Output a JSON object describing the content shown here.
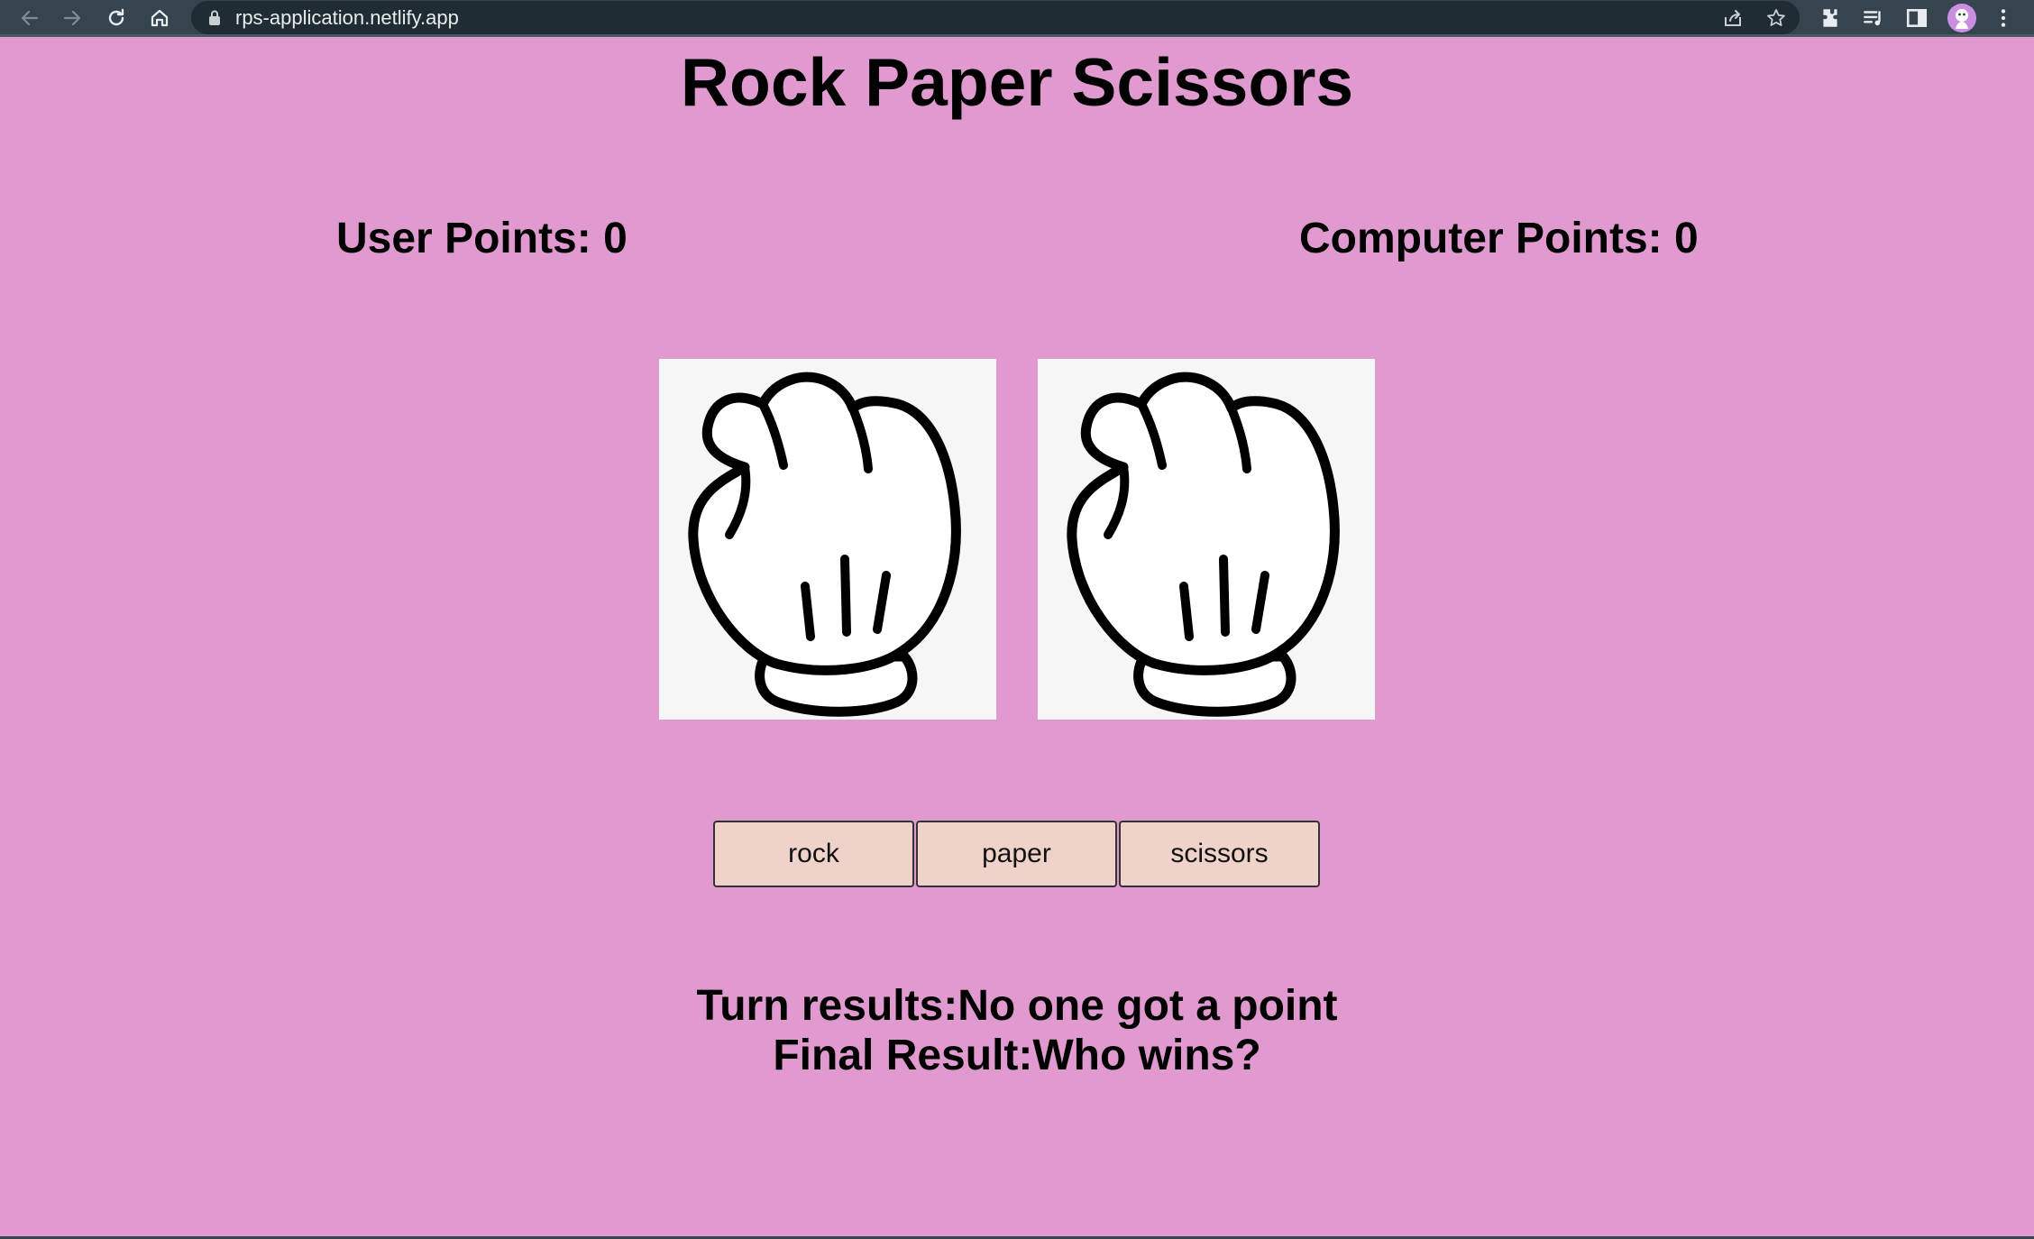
{
  "browser": {
    "url": "rps-application.netlify.app",
    "icons": [
      "back-icon",
      "forward-icon",
      "reload-icon",
      "home-icon",
      "lock-icon",
      "share-icon",
      "star-icon",
      "extensions-icon",
      "reading-list-icon",
      "side-panel-icon",
      "avatar-icon",
      "menu-icon"
    ]
  },
  "page": {
    "title": "Rock Paper Scissors",
    "user_points_label": "User Points: 0",
    "computer_points_label": "Computer Points: 0",
    "hands": {
      "user": "rock-hand-icon",
      "computer": "rock-hand-icon"
    },
    "buttons": {
      "rock": "rock",
      "paper": "paper",
      "scissors": "scissors"
    },
    "turn_results": "Turn results:No one got a point",
    "final_result": "Final Result:Who wins?"
  },
  "colors": {
    "background": "#e09ad0",
    "chrome": "#35444e",
    "button": "#efd3cb",
    "card": "#f7f6f6"
  }
}
